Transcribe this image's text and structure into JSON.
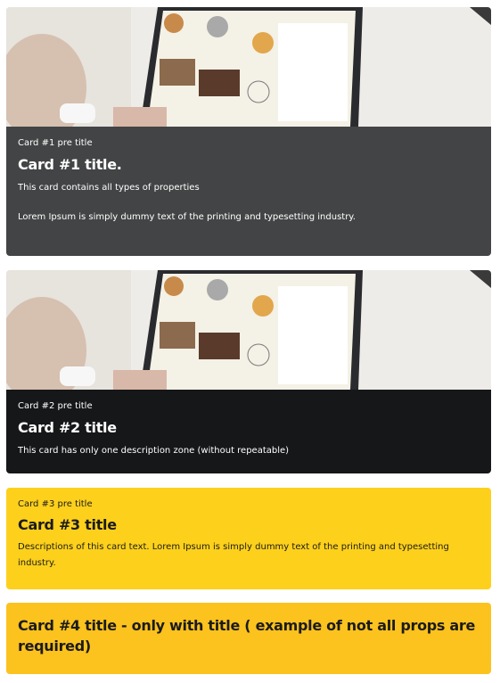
{
  "cards": [
    {
      "pre_title": "Card #1 pre title",
      "title": "Card #1 title.",
      "descriptions": [
        "This card contains all types of properties",
        "Lorem Ipsum is simply dummy text of the printing and typesetting industry."
      ]
    },
    {
      "pre_title": "Card #2 pre title",
      "title": "Card #2 title",
      "descriptions": [
        "This card has only one description zone (without repeatable)"
      ]
    },
    {
      "pre_title": "Card #3 pre title",
      "title": "Card #3 title",
      "descriptions": [
        "Descriptions of this card text. Lorem Ipsum is simply dummy text of the printing and typesetting industry."
      ]
    },
    {
      "title": "Card #4 title - only with title ( example of not all props are required)"
    }
  ],
  "colors": {
    "card1_bg": "#434445",
    "card2_bg": "#161719",
    "card3_bg": "#fdd01c",
    "card4_bg": "#fcc21e"
  }
}
